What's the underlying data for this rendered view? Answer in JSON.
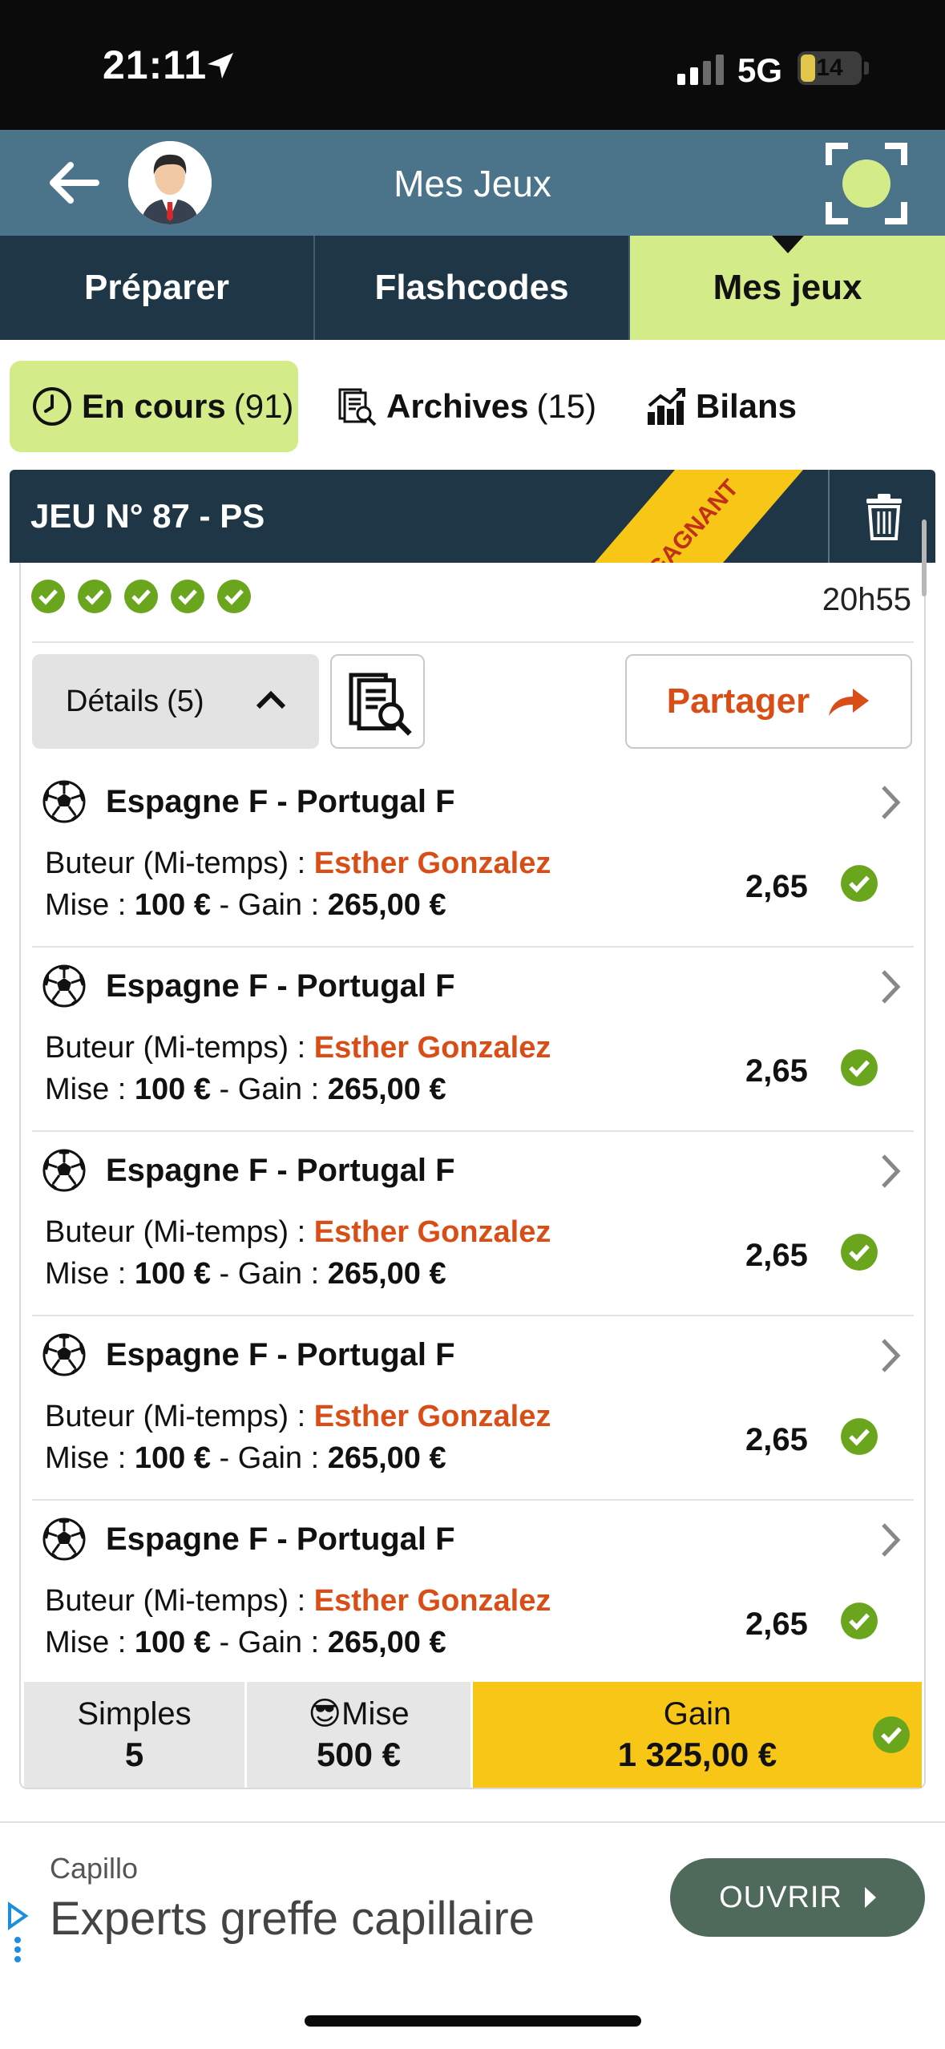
{
  "status_bar": {
    "time": "21:11",
    "network": "5G",
    "battery": "14"
  },
  "header": {
    "title": "Mes Jeux"
  },
  "tabs": [
    {
      "label": "Préparer"
    },
    {
      "label": "Flashcodes"
    },
    {
      "label": "Mes jeux"
    }
  ],
  "subtabs": {
    "current": {
      "label": "En cours",
      "count": "(91)"
    },
    "archives": {
      "label": "Archives",
      "count": "(15)"
    },
    "reports": {
      "label": "Bilans"
    }
  },
  "game": {
    "title": "JEU N° 87 - PS",
    "ribbon": "GAGNANT",
    "time": "20h55",
    "details_label": "Détails",
    "details_count": "(5)",
    "share_label": "Partager",
    "bets": [
      {
        "match": "Espagne F - Portugal F",
        "market": "Buteur (Mi-temps) : ",
        "selection": "Esther Gonzalez",
        "stake_label": "Mise : ",
        "stake": "100 €",
        "gain_label": " - Gain : ",
        "gain": "265,00 €",
        "odds": "2,65"
      },
      {
        "match": "Espagne F - Portugal F",
        "market": "Buteur (Mi-temps) : ",
        "selection": "Esther Gonzalez",
        "stake_label": "Mise : ",
        "stake": "100 €",
        "gain_label": " - Gain : ",
        "gain": "265,00 €",
        "odds": "2,65"
      },
      {
        "match": "Espagne F - Portugal F",
        "market": "Buteur (Mi-temps) : ",
        "selection": "Esther Gonzalez",
        "stake_label": "Mise : ",
        "stake": "100 €",
        "gain_label": " - Gain : ",
        "gain": "265,00 €",
        "odds": "2,65"
      },
      {
        "match": "Espagne F - Portugal F",
        "market": "Buteur (Mi-temps) : ",
        "selection": "Esther Gonzalez",
        "stake_label": "Mise : ",
        "stake": "100 €",
        "gain_label": " - Gain : ",
        "gain": "265,00 €",
        "odds": "2,65"
      },
      {
        "match": "Espagne F - Portugal F",
        "market": "Buteur (Mi-temps) : ",
        "selection": "Esther Gonzalez",
        "stake_label": "Mise : ",
        "stake": "100 €",
        "gain_label": " - Gain : ",
        "gain": "265,00 €",
        "odds": "2,65"
      }
    ],
    "totals": {
      "simples_label": "Simples",
      "simples_value": "5",
      "stake_label": "😎Mise",
      "stake_value": "500 €",
      "gain_label": "Gain",
      "gain_value": "1 325,00 €"
    }
  },
  "ad": {
    "brand": "Capillo",
    "headline": "Experts greffe capillaire",
    "button": "OUVRIR"
  },
  "colors": {
    "header": "#4b7389",
    "navy": "#1e3646",
    "lime": "#d3ec89",
    "orange": "#d94e17",
    "gold": "#f7c617",
    "green": "#6aa51e"
  }
}
